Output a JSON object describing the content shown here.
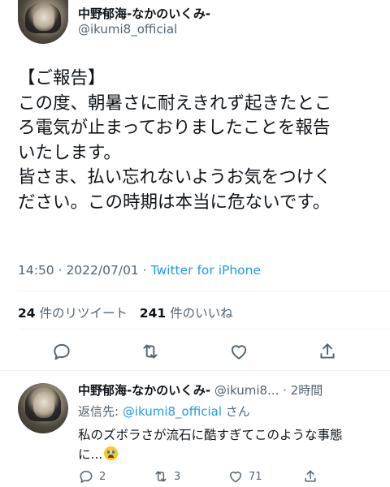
{
  "tweet": {
    "author_name": "中野郁海-なかのいくみ-",
    "author_handle": "@ikumi8_official",
    "lines": [
      "【ご報告】",
      "この度、朝暑さに耐えきれず起きたとこ",
      "ろ電気が止まっておりましたことを報告",
      "いたします。",
      "皆さま、払い忘れないようお気をつけく",
      "ださい。この時期は本当に危ないです。"
    ],
    "time": "14:50 · 2022/07/01 · ",
    "source": "Twitter for iPhone",
    "retweets_count": "24",
    "retweets_label": " 件のリツイート",
    "likes_count": "241",
    "likes_label": " 件のいいね"
  },
  "actions": {
    "reply_icon": "reply-icon",
    "retweet_icon": "retweet-icon",
    "like_icon": "heart-icon",
    "share_icon": "share-icon"
  },
  "reply": {
    "author_name": "中野郁海-なかのいくみ-",
    "author_handle": " @ikumi8...",
    "time": " · 2時間",
    "reply_to_prefix": "返信先: ",
    "reply_to_mention": "@ikumi8_official",
    "reply_to_suffix": " さん",
    "text_line1": "私のズボラさが流石に酷すぎてこのような事態",
    "text_line2": "に...",
    "emoji": "crying-face-emoji",
    "reply_count": "2",
    "retweet_count": "3",
    "like_count": "71"
  },
  "colors": {
    "link": "#1d9bf0",
    "secondary_text": "#536471",
    "primary_text": "#0f1419",
    "divider": "#eff3f4"
  }
}
